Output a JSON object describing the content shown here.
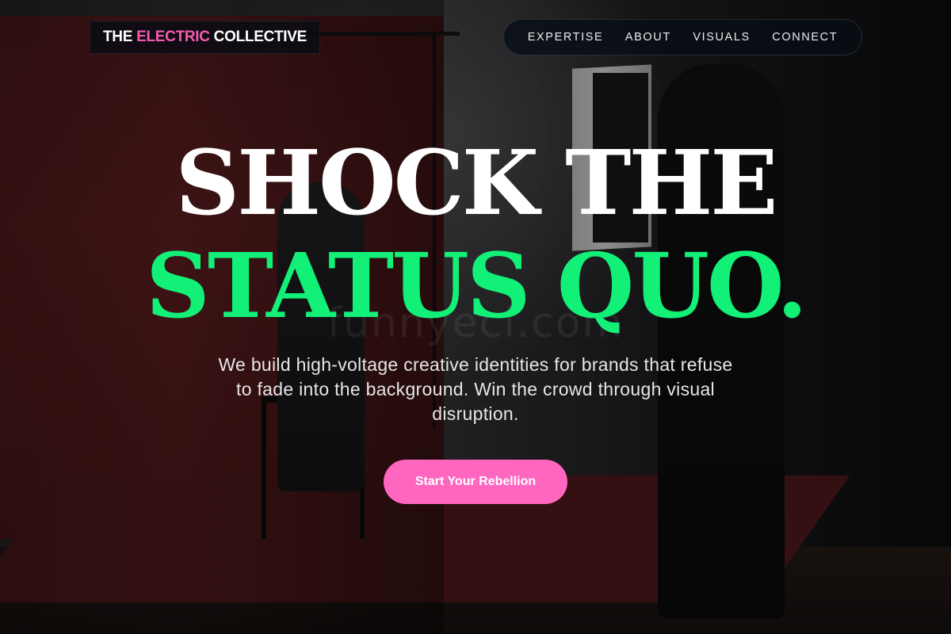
{
  "brand": {
    "part1": "THE ",
    "accent": "ELECTRIC",
    "part2": " COLLECTIVE",
    "accent_color": "#f35bb0"
  },
  "nav": {
    "items": [
      {
        "label": "EXPERTISE"
      },
      {
        "label": "ABOUT"
      },
      {
        "label": "VISUALS"
      },
      {
        "label": "CONNECT"
      }
    ]
  },
  "hero": {
    "line1": "SHOCK THE",
    "line2": "STATUS QUO.",
    "line2_color": "#12f078",
    "subtitle": "We build high-voltage creative identities for brands that refuse to fade into the background. Win the crowd through visual disruption.",
    "cta_label": "Start Your Rebellion",
    "cta_color": "#ff66c0"
  },
  "watermark": "funnyecl.com",
  "background": {
    "description_icon": "photo-studio-background"
  }
}
